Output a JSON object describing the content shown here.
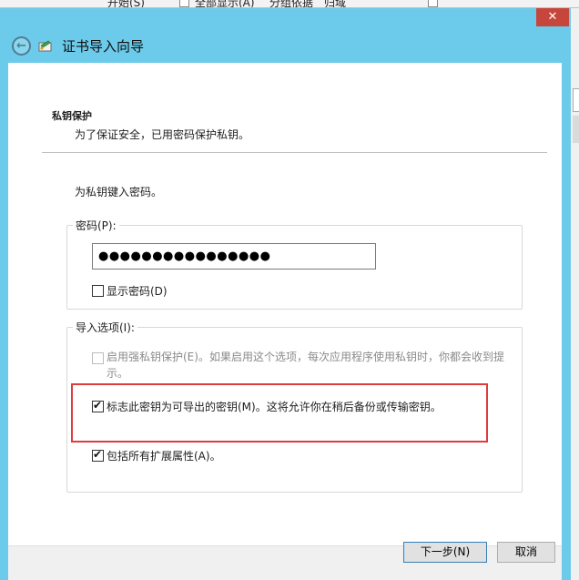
{
  "background": {
    "strip_items": [
      "开始(S)",
      "全部显示(A)",
      "分组依据",
      "归域"
    ]
  },
  "window": {
    "title": "证书导入向导",
    "close_glyph": "✕",
    "back_glyph": "←"
  },
  "header": {
    "title": "私钥保护",
    "subtitle": "为了保证安全，已用密码保护私钥。"
  },
  "prompt": "为私钥键入密码。",
  "password_group": {
    "label": "密码(P):",
    "value": "●●●●●●●●●●●●●●●●",
    "show_password_label": "显示密码(D)",
    "show_password_checked": false
  },
  "import_options": {
    "label": "导入选项(I):",
    "options": [
      {
        "label": "启用强私钥保护(E)。如果启用这个选项，每次应用程序使用私钥时，你都会收到提示。",
        "checked": false,
        "enabled": false
      },
      {
        "label": "标志此密钥为可导出的密钥(M)。这将允许你在稍后备份或传输密钥。",
        "checked": true,
        "enabled": true,
        "highlighted": true
      },
      {
        "label": "包括所有扩展属性(A)。",
        "checked": true,
        "enabled": true
      }
    ]
  },
  "buttons": {
    "next": "下一步(N)",
    "cancel": "取消"
  },
  "colors": {
    "title_bar": "#6ccaea",
    "close_button": "#c7463b",
    "highlight_border": "#e03c3c"
  }
}
